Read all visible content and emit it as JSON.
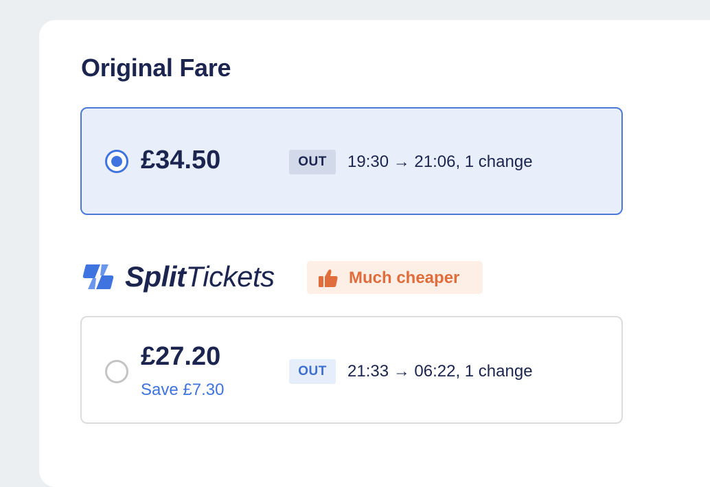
{
  "original_fare": {
    "title": "Original Fare",
    "price": "£34.50",
    "direction": "OUT",
    "journey": "19:30 → 21:06, 1 change",
    "selected": true
  },
  "split_tickets": {
    "brand_bold": "Split",
    "brand_light": "Tickets",
    "badge": "Much cheaper",
    "fare": {
      "price": "£27.20",
      "saving": "Save £7.30",
      "direction": "OUT",
      "journey": "21:33 → 06:22, 1 change",
      "selected": false
    }
  },
  "icons": {
    "brand_logo": "lightning-bolt-icon",
    "badge_icon": "thumbs-up-icon",
    "radio_on": "radio-selected-icon",
    "radio_off": "radio-unselected-icon"
  },
  "colors": {
    "navy": "#1b2550",
    "accent_blue": "#3f73e0",
    "selected_bg": "#e8effb",
    "badge_orange": "#e06d3c",
    "badge_bg": "#fdeee6"
  }
}
